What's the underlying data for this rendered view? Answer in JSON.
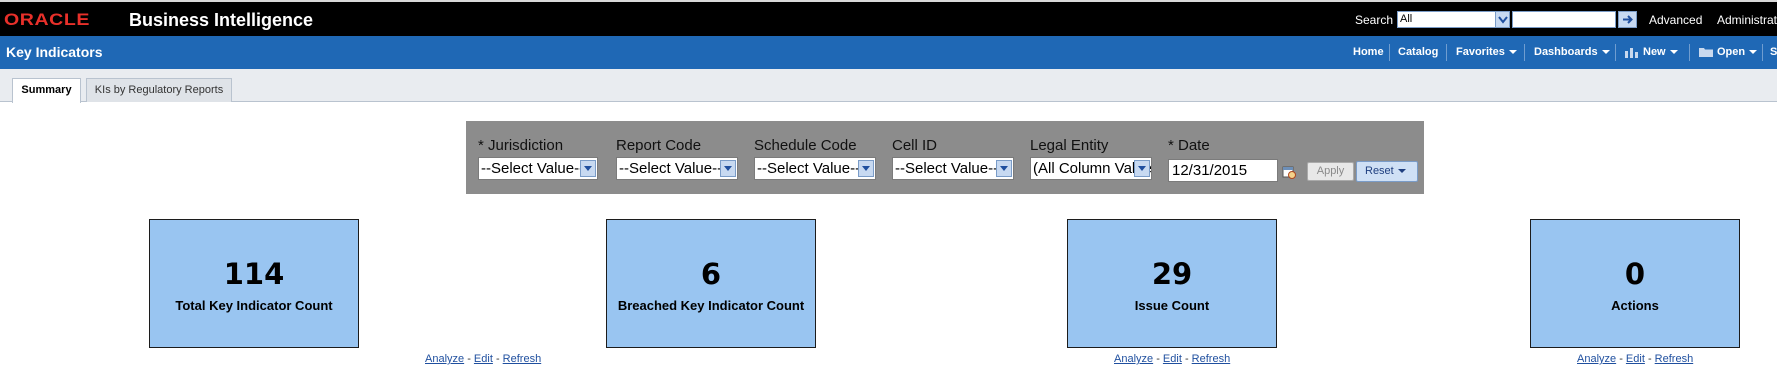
{
  "header": {
    "logo": "ORACLE",
    "app_name": "Business Intelligence",
    "search_label": "Search",
    "search_scope": "All",
    "search_value": "",
    "advanced": "Advanced",
    "administration": "Administration"
  },
  "page": {
    "title": "Key Indicators"
  },
  "nav": {
    "home": "Home",
    "catalog": "Catalog",
    "favorites": "Favorites",
    "dashboards": "Dashboards",
    "new": "New",
    "open": "Open",
    "more": "S"
  },
  "tabs": [
    {
      "label": "Summary",
      "active": true
    },
    {
      "label": "KIs by Regulatory Reports",
      "active": false
    }
  ],
  "prompts": {
    "jurisdiction": {
      "label": "* Jurisdiction",
      "value": "--Select Value--"
    },
    "report_code": {
      "label": "Report Code",
      "value": "--Select Value--"
    },
    "schedule_code": {
      "label": "Schedule Code",
      "value": "--Select Value--"
    },
    "cell_id": {
      "label": "Cell ID",
      "value": "--Select Value--"
    },
    "legal_entity": {
      "label": "Legal Entity",
      "value": "(All Column Values)"
    },
    "date": {
      "label": "* Date",
      "value": "12/31/2015"
    },
    "apply": "Apply",
    "reset": "Reset"
  },
  "tiles": [
    {
      "value": "114",
      "label": "Total Key Indicator Count"
    },
    {
      "value": "6",
      "label": "Breached Key Indicator Count"
    },
    {
      "value": "29",
      "label": "Issue Count"
    },
    {
      "value": "0",
      "label": "Actions"
    }
  ],
  "links": {
    "analyze": "Analyze",
    "edit": "Edit",
    "refresh": "Refresh",
    "sep": " - "
  },
  "colors": {
    "header_black": "#000000",
    "header_blue": "#1f68b5",
    "tile_fill": "#99c5f1",
    "prompt_panel": "#8c8c8c",
    "oracle_red": "#e8302a"
  }
}
